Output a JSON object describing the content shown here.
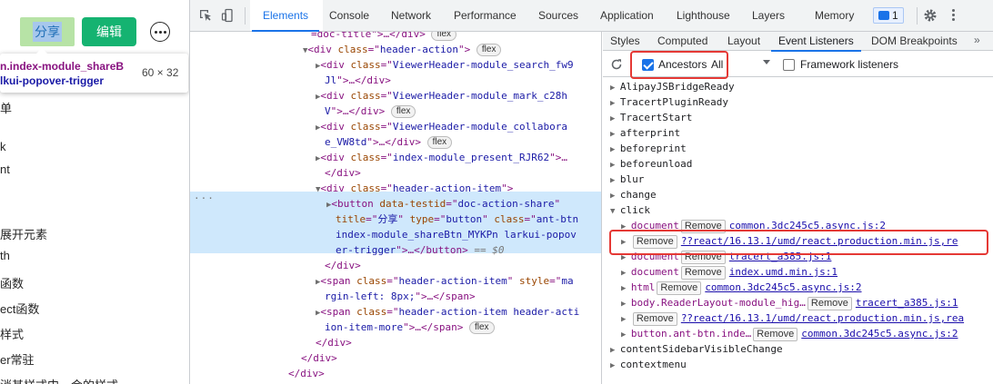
{
  "page": {
    "share_label": "分享",
    "edit_label": "编辑",
    "tooltip": {
      "selector_line1": "n.index-module_shareB",
      "selector_line2": "lkui-popover-trigger",
      "size": "60 × 32"
    },
    "side_lines": [
      "单",
      "k",
      "nt",
      "展开元素",
      "th",
      "函数",
      "ect函数",
      "样式",
      "er常驻",
      "消其样式中一会的样式"
    ]
  },
  "devtools": {
    "main_tabs": [
      "Elements",
      "Console",
      "Network",
      "Performance",
      "Sources",
      "Application",
      "Lighthouse",
      "Layers",
      "Memory"
    ],
    "issues_count": "1",
    "elements_lines": [
      {
        "i": 133,
        "h": "<span class='tw'>=doc-title\"&gt;…&lt;/div&gt;</span> <span class='pill'>flex</span>"
      },
      {
        "i": 124,
        "h": "<span class='tri'>▼</span><span class='tg'>&lt;div</span> <span class='an'>class</span><span class='tg'>=\"</span><span class='av'>header-action</span><span class='tg'>\"&gt;</span> <span class='pill'>flex</span>"
      },
      {
        "i": 138,
        "h": "<span class='tri'>▶</span><span class='tg'>&lt;div</span> <span class='an'>class</span><span class='tg'>=\"</span><span class='av'>ViewerHeader-module_search_fw9</span>"
      },
      {
        "i": 148,
        "h": "<span class='av'>Jl</span><span class='tg'>\"&gt;…&lt;/div&gt;</span>"
      },
      {
        "i": 138,
        "h": "<span class='tri'>▶</span><span class='tg'>&lt;div</span> <span class='an'>class</span><span class='tg'>=\"</span><span class='av'>ViewerHeader-module_mark_c28h</span>"
      },
      {
        "i": 148,
        "h": "<span class='av'>V</span><span class='tg'>\"&gt;…&lt;/div&gt;</span> <span class='pill'>flex</span>"
      },
      {
        "i": 138,
        "h": "<span class='tri'>▶</span><span class='tg'>&lt;div</span> <span class='an'>class</span><span class='tg'>=\"</span><span class='av'>ViewerHeader-module_collabora</span>"
      },
      {
        "i": 148,
        "h": "<span class='av'>e_VW8td</span><span class='tg'>\"&gt;…&lt;/div&gt;</span> <span class='pill'>flex</span>"
      },
      {
        "i": 138,
        "h": "<span class='tri'>▶</span><span class='tg'>&lt;div</span> <span class='an'>class</span><span class='tg'>=\"</span><span class='av'>index-module_present_RJR62</span><span class='tg'>\"&gt;…</span>"
      },
      {
        "i": 148,
        "h": "<span class='tg'>&lt;/div&gt;</span>"
      },
      {
        "i": 138,
        "h": "<span class='tri'>▼</span><span class='tg'>&lt;div</span> <span class='an'>class</span><span class='tg'>=\"</span><span class='av'>header-action-item</span><span class='tg'>\"&gt;</span>"
      },
      {
        "i": 150,
        "h": "<span class='tri'>▶</span><span class='tg'>&lt;button</span> <span class='an'>data-testid</span><span class='tg'>=\"</span><span class='av'>doc-action-share</span><span class='tg'>\"</span>"
      },
      {
        "i": 160,
        "h": "<span class='an'>title</span><span class='tg'>=\"</span><span class='av'>分享</span><span class='tg'>\"</span> <span class='an'>type</span><span class='tg'>=\"</span><span class='av'>button</span><span class='tg'>\"</span> <span class='an'>class</span><span class='tg'>=\"</span><span class='av'>ant-btn</span>"
      },
      {
        "i": 160,
        "h": "<span class='av'>index-module_shareBtn_MYKPn larkui-popov</span>"
      },
      {
        "i": 160,
        "h": "<span class='av'>er-trigger</span><span class='tg'>\"&gt;…&lt;/button&gt;</span> <span class='eq'>==</span> <span class='ds'>$0</span>"
      },
      {
        "i": 148,
        "h": "<span class='tg'>&lt;/div&gt;</span>"
      },
      {
        "i": 138,
        "h": "<span class='tri'>▶</span><span class='tg'>&lt;span</span> <span class='an'>class</span><span class='tg'>=\"</span><span class='av'>header-action-item</span><span class='tg'>\"</span> <span class='an'>style</span><span class='tg'>=\"</span><span class='av'>ma</span>"
      },
      {
        "i": 148,
        "h": "<span class='av'>rgin-left: 8px;</span><span class='tg'>\"&gt;…&lt;/span&gt;</span>"
      },
      {
        "i": 138,
        "h": "<span class='tri'>▶</span><span class='tg'>&lt;span</span> <span class='an'>class</span><span class='tg'>=\"</span><span class='av'>header-action-item header-acti</span>"
      },
      {
        "i": 148,
        "h": "<span class='av'>ion-item-more</span><span class='tg'>\"&gt;…&lt;/span&gt;</span> <span class='pill'>flex</span>"
      },
      {
        "i": 138,
        "h": "<span class='tg'>&lt;/div&gt;</span>"
      },
      {
        "i": 122,
        "h": "<span class='tg'>&lt;/div&gt;</span>"
      },
      {
        "i": 108,
        "h": "<span class='tg'>&lt;/div&gt;</span>"
      },
      {
        "i": 96,
        "h": "<span class='tg'>&lt;/div&gt;</span>"
      }
    ],
    "sidebar_tabs": [
      "Styles",
      "Computed",
      "Layout",
      "Event Listeners",
      "DOM Breakpoints"
    ],
    "sidebar_more": "»",
    "ancestors_label": "Ancestors",
    "all_option": "All",
    "framework_label": "Framework listeners",
    "events": [
      {
        "i": 8,
        "t": "▶",
        "name": "AlipayJSBridgeReady"
      },
      {
        "i": 8,
        "t": "▶",
        "name": "TracertPluginReady"
      },
      {
        "i": 8,
        "t": "▶",
        "name": "TracertStart"
      },
      {
        "i": 8,
        "t": "▶",
        "name": "afterprint"
      },
      {
        "i": 8,
        "t": "▶",
        "name": "beforeprint"
      },
      {
        "i": 8,
        "t": "▶",
        "name": "beforeunload"
      },
      {
        "i": 8,
        "t": "▶",
        "name": "blur"
      },
      {
        "i": 8,
        "t": "▶",
        "name": "change"
      },
      {
        "i": 8,
        "t": "▼",
        "name": "click"
      },
      {
        "i": 20,
        "t": "▶",
        "node": "document",
        "remove": "Remove",
        "link": "common.3dc245c5.async.js:2"
      },
      {
        "i": 20,
        "t": "▶",
        "node": "",
        "remove": "Remove",
        "link": "??react/16.13.1/umd/react.production.min.js,re"
      },
      {
        "i": 20,
        "t": "▶",
        "node": "document",
        "remove": "Remove",
        "link": "tracert_a385.js:1"
      },
      {
        "i": 20,
        "t": "▶",
        "node": "document",
        "remove": "Remove",
        "link": "index.umd.min.js:1"
      },
      {
        "i": 20,
        "t": "▶",
        "node": "html",
        "remove": "Remove",
        "link": "common.3dc245c5.async.js:2"
      },
      {
        "i": 20,
        "t": "▶",
        "node": "body.ReaderLayout-module_hig…",
        "remove": "Remove",
        "link": "tracert_a385.js:1"
      },
      {
        "i": 20,
        "t": "▶",
        "node": "",
        "remove": "Remove",
        "link": "??react/16.13.1/umd/react.production.min.js,rea"
      },
      {
        "i": 20,
        "t": "▶",
        "node": "button.ant-btn.inde…",
        "remove": "Remove",
        "link": "common.3dc245c5.async.js:2"
      },
      {
        "i": 8,
        "t": "▶",
        "name": "contentSidebarVisibleChange"
      },
      {
        "i": 8,
        "t": "▶",
        "name": "contextmenu"
      }
    ]
  }
}
